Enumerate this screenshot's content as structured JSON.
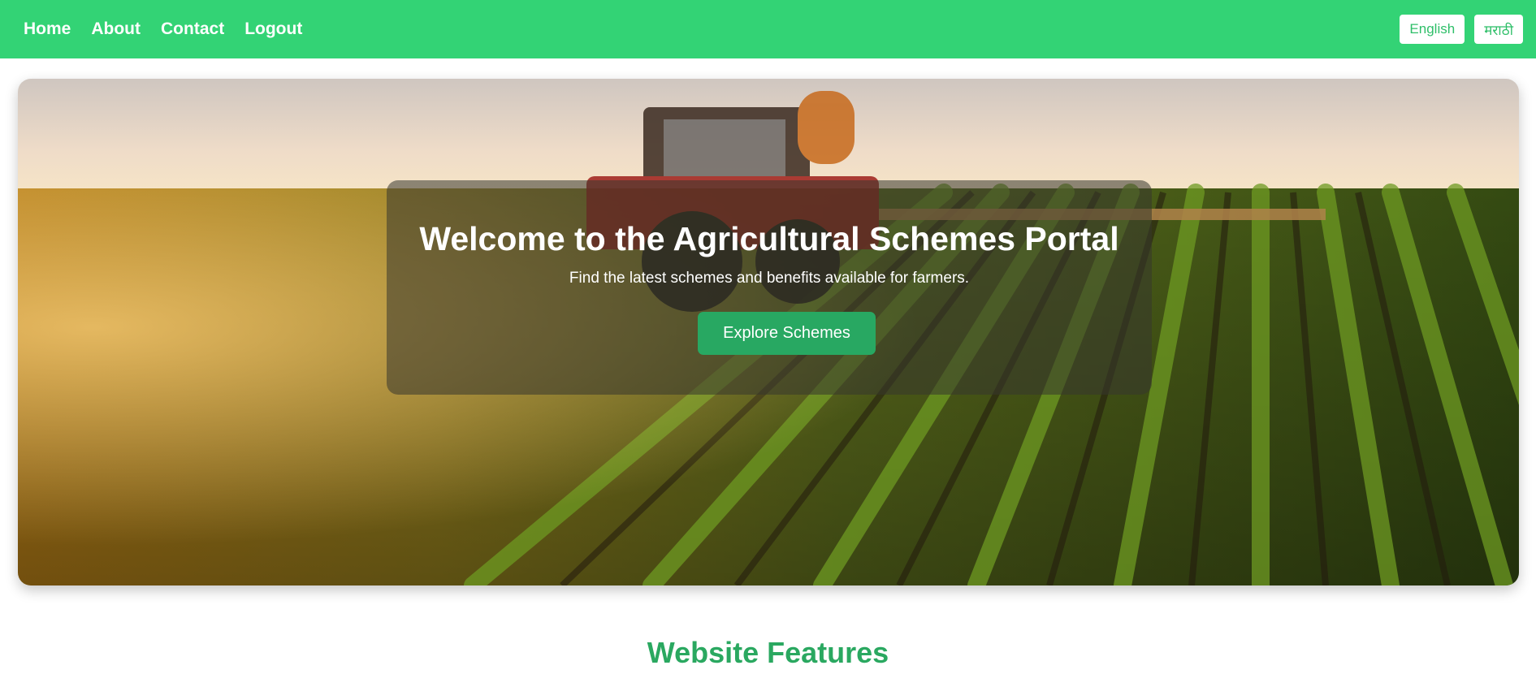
{
  "nav": {
    "links": [
      "Home",
      "About",
      "Contact",
      "Logout"
    ],
    "languages": [
      "English",
      "मराठी"
    ]
  },
  "hero": {
    "title": "Welcome to the Agricultural Schemes Portal",
    "subtitle": "Find the latest schemes and benefits available for farmers.",
    "cta_label": "Explore Schemes",
    "background_image": "farm-field-with-tractor"
  },
  "features": {
    "heading": "Website Features"
  },
  "colors": {
    "nav_bg": "#33d375",
    "accent_green": "#28a862",
    "heading_green": "#2aa860"
  }
}
